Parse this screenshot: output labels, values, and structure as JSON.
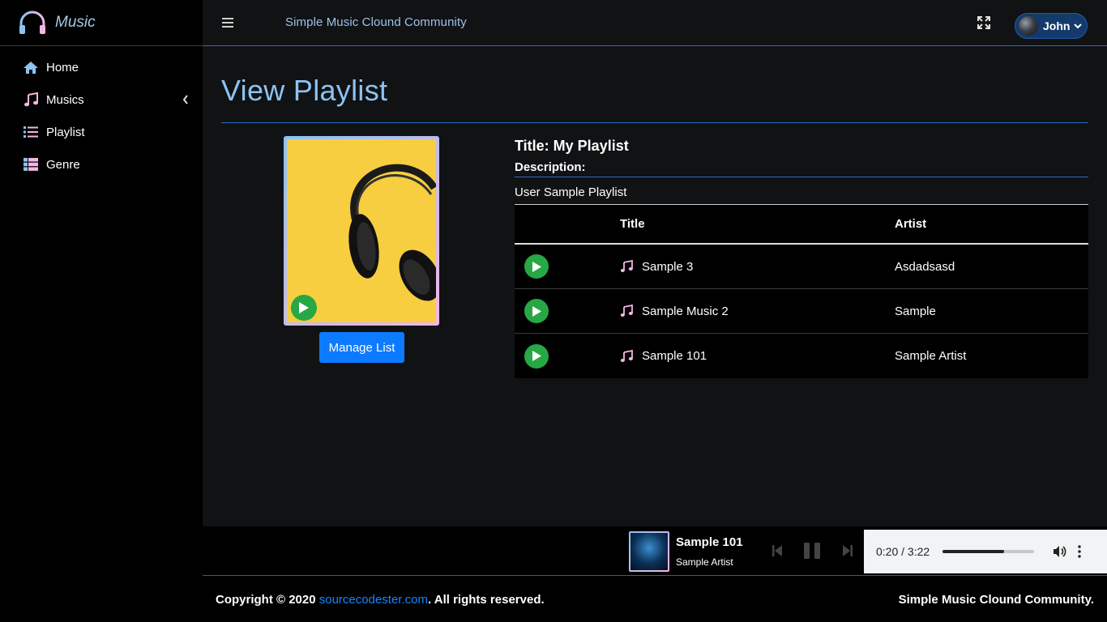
{
  "brand": {
    "name": "Music"
  },
  "sidebar": {
    "items": [
      {
        "label": "Home",
        "icon": "home-icon"
      },
      {
        "label": "Musics",
        "icon": "music-note-icon"
      },
      {
        "label": "Playlist",
        "icon": "list-icon"
      },
      {
        "label": "Genre",
        "icon": "table-list-icon"
      }
    ]
  },
  "header": {
    "site_title": "Simple Music Clound Community",
    "user_name": "John"
  },
  "page": {
    "title": "View Playlist",
    "playlist_title": "Title: My Playlist",
    "description_label": "Description:",
    "description": "User Sample Playlist",
    "manage_button": "Manage List"
  },
  "table": {
    "headers": [
      "",
      "Title",
      "Artist"
    ],
    "rows": [
      {
        "title": "Sample 3",
        "artist": "Asdadsasd"
      },
      {
        "title": "Sample Music 2",
        "artist": "Sample"
      },
      {
        "title": "Sample 101",
        "artist": "Sample Artist"
      }
    ]
  },
  "player": {
    "title": "Sample 101",
    "artist": "Sample Artist",
    "time": "0:20 / 3:22",
    "progress_fraction": 0.67
  },
  "footer": {
    "copyright_prefix": "Copyright © 2020 ",
    "link_text": "sourcecodester.com",
    "copyright_suffix": ". All rights reserved.",
    "right_text": "Simple Music Clound Community."
  },
  "colors": {
    "accent_blue": "#8ec2f2",
    "accent_pink": "#f4b6e3",
    "play_green": "#28a745",
    "button_blue": "#0d7bff"
  }
}
